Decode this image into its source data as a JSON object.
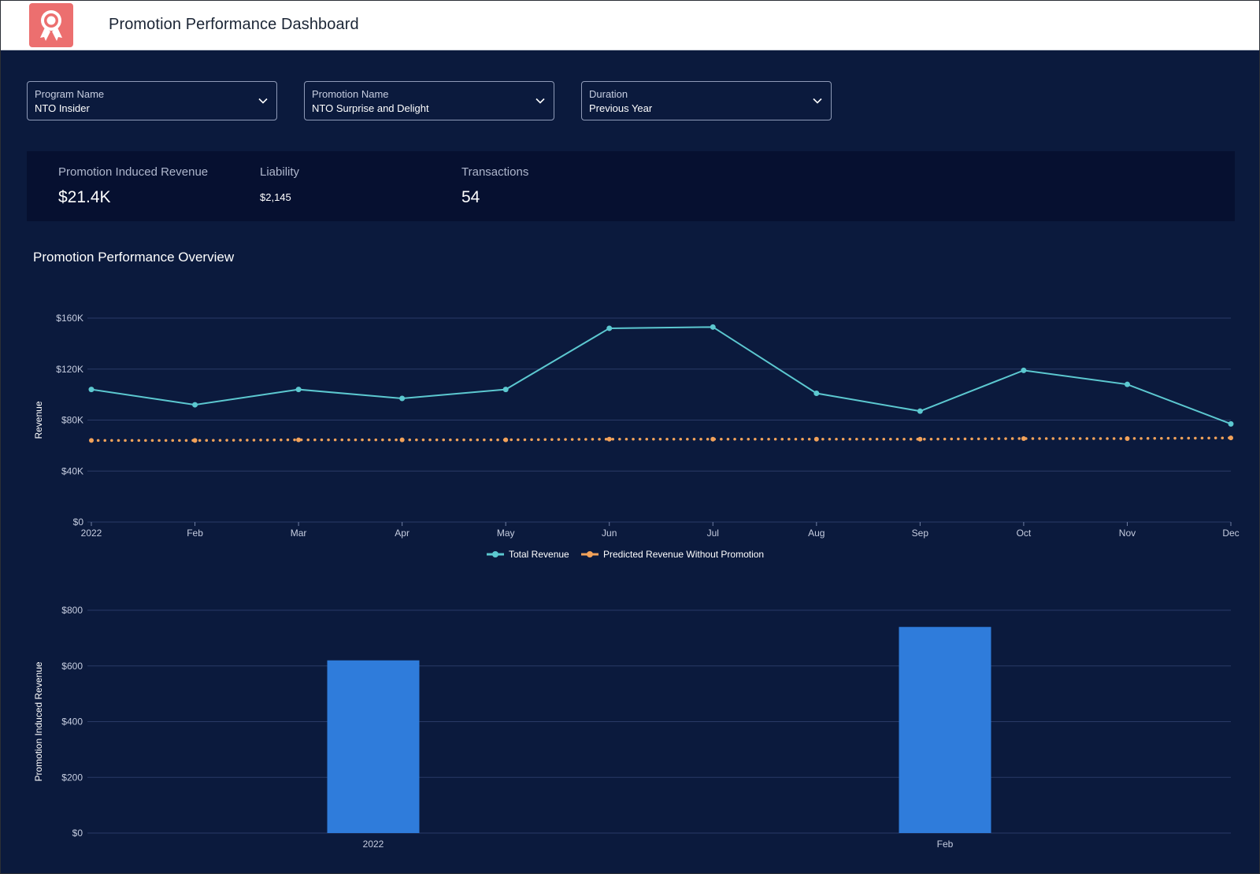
{
  "header": {
    "title": "Promotion Performance Dashboard",
    "app_icon": "award-ribbon-icon",
    "icon_color": "#ec6f6f"
  },
  "filters": [
    {
      "label": "Program Name",
      "value": "NTO Insider",
      "icon": "chevron-down-icon"
    },
    {
      "label": "Promotion Name",
      "value": "NTO Surprise and Delight",
      "icon": "chevron-down-icon"
    },
    {
      "label": "Duration",
      "value": "Previous Year",
      "icon": "chevron-down-icon"
    }
  ],
  "kpis": [
    {
      "label": "Promotion Induced Revenue",
      "value": "$21.4K"
    },
    {
      "label": "Liability",
      "value": "$2,145"
    },
    {
      "label": "Transactions",
      "value": "54"
    }
  ],
  "section": {
    "title": "Promotion Performance Overview"
  },
  "colors": {
    "background": "#0b1a3d",
    "kpi_panel": "#061030",
    "total_revenue": "#5cc8d0",
    "predicted_revenue": "#f2a25a",
    "bar": "#2f7cdb",
    "grid": "#2a3a66"
  },
  "chart_data": [
    {
      "type": "line",
      "title": "",
      "ylabel": "Revenue",
      "xlabel": "",
      "categories": [
        "2022",
        "Feb",
        "Mar",
        "Apr",
        "May",
        "Jun",
        "Jul",
        "Aug",
        "Sep",
        "Oct",
        "Nov",
        "Dec"
      ],
      "ylim": [
        0,
        160000
      ],
      "y_ticks": [
        0,
        40000,
        80000,
        120000,
        160000
      ],
      "y_tick_labels": [
        "$0",
        "$40K",
        "$80K",
        "$120K",
        "$160K"
      ],
      "grid": true,
      "legend": "bottom-center",
      "series": [
        {
          "name": "Total Revenue",
          "values": [
            104000,
            92000,
            104000,
            97000,
            104000,
            152000,
            153000,
            101000,
            87000,
            119000,
            108000,
            77000
          ]
        },
        {
          "name": "Predicted Revenue Without Promotion",
          "values": [
            64000,
            64000,
            64500,
            64500,
            64500,
            65000,
            65000,
            65000,
            65000,
            65500,
            65500,
            66000
          ]
        }
      ]
    },
    {
      "type": "bar",
      "title": "",
      "ylabel": "Promotion Induced Revenue",
      "xlabel": "",
      "categories": [
        "2022",
        "Feb"
      ],
      "values": [
        620,
        740
      ],
      "ylim": [
        0,
        800
      ],
      "y_ticks": [
        0,
        200,
        400,
        600,
        800
      ],
      "y_tick_labels": [
        "$0",
        "$200",
        "$400",
        "$600",
        "$800"
      ],
      "grid": true
    }
  ]
}
